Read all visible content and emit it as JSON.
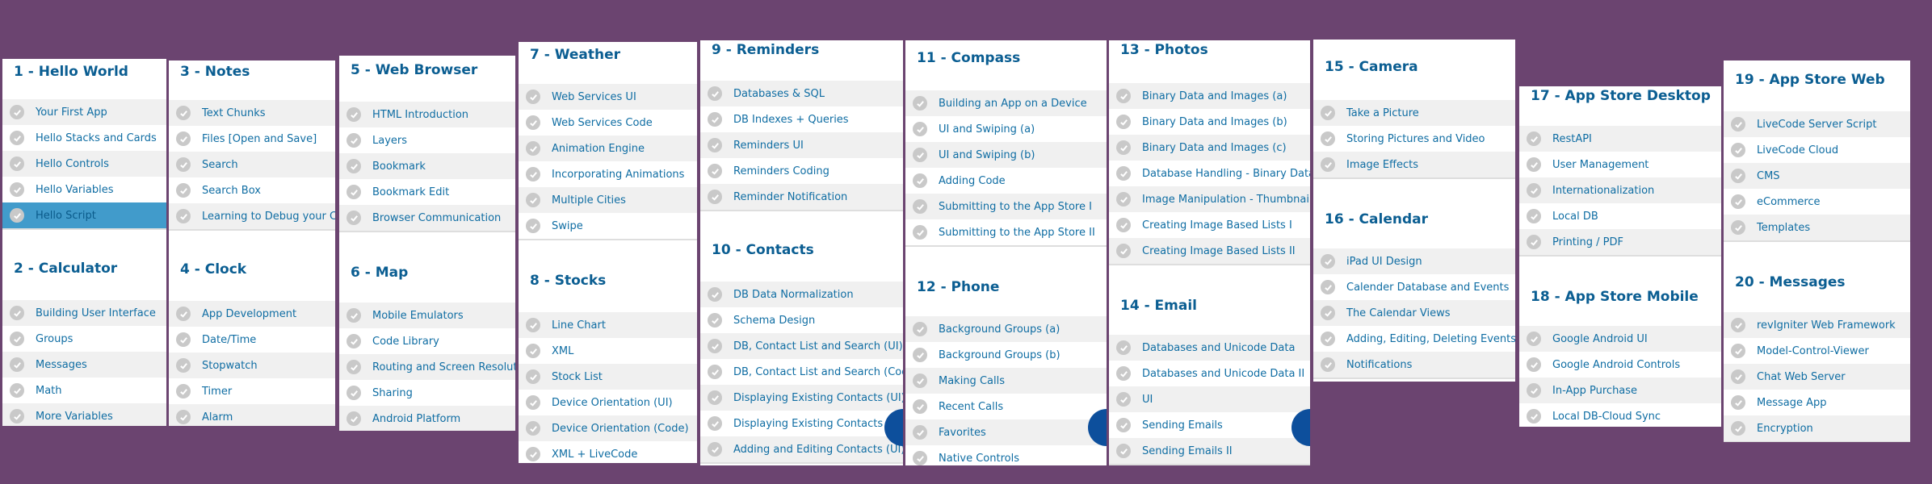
{
  "colors": {
    "background": "#6b4470",
    "title": "#0b5e92",
    "item_text": "#0f6da3",
    "selected_row": "#419bcb",
    "check_icon": "#c9c9c9",
    "fab": "#0d4f9c"
  },
  "columns": [
    {
      "sections": [
        {
          "title": "1 - Hello World",
          "items": [
            "Your First App",
            "Hello Stacks and Cards",
            "Hello Controls",
            "Hello Variables",
            "Hello Script"
          ],
          "selected_index": 4
        },
        {
          "title": "2 - Calculator",
          "items": [
            "Building User Interface",
            "Groups",
            "Messages",
            "Math",
            "More Variables"
          ]
        }
      ]
    },
    {
      "sections": [
        {
          "title": "3 - Notes",
          "items": [
            "Text Chunks",
            "Files [Open and Save]",
            "Search",
            "Search Box",
            "Learning to Debug your Code"
          ]
        },
        {
          "title": "4 - Clock",
          "items": [
            "App Development",
            "Date/Time",
            "Stopwatch",
            "Timer",
            "Alarm"
          ]
        }
      ]
    },
    {
      "sections": [
        {
          "title": "5 - Web Browser",
          "items": [
            "HTML Introduction",
            "Layers",
            "Bookmark",
            "Bookmark Edit",
            "Browser Communication"
          ]
        },
        {
          "title": "6 - Map",
          "items": [
            "Mobile Emulators",
            "Code Library",
            "Routing and Screen Resolution",
            "Sharing",
            "Android Platform"
          ]
        }
      ]
    },
    {
      "sections": [
        {
          "title": "7 - Weather",
          "items": [
            "Web Services UI",
            "Web Services Code",
            "Animation Engine",
            "Incorporating Animations",
            "Multiple Cities",
            "Swipe"
          ]
        },
        {
          "title": "8 - Stocks",
          "items": [
            "Line Chart",
            "XML",
            "Stock List",
            "Device Orientation (UI)",
            "Device Orientation (Code)",
            "XML + LiveCode"
          ]
        }
      ]
    },
    {
      "sections": [
        {
          "title": "9 - Reminders",
          "items": [
            "Databases & SQL",
            "DB Indexes + Queries",
            "Reminders UI",
            "Reminders Coding",
            "Reminder Notification"
          ]
        },
        {
          "title": "10 - Contacts",
          "items": [
            "DB Data Normalization",
            "Schema Design",
            "DB, Contact List and Search (UI)",
            "DB, Contact List and Search (Code)",
            "Displaying Existing Contacts (UI)",
            "Displaying Existing Contacts (Code)",
            "Adding and Editing Contacts (UI)"
          ]
        }
      ]
    },
    {
      "sections": [
        {
          "title": "11 - Compass",
          "items": [
            "Building an App on a Device",
            "UI and Swiping (a)",
            "UI and Swiping (b)",
            "Adding Code",
            "Submitting to the App Store I",
            "Submitting to the App Store II"
          ]
        },
        {
          "title": "12 - Phone",
          "items": [
            "Background Groups (a)",
            "Background Groups (b)",
            "Making Calls",
            "Recent Calls",
            "Favorites",
            "Native Controls"
          ]
        }
      ]
    },
    {
      "sections": [
        {
          "title": "13 - Photos",
          "items": [
            "Binary Data and Images (a)",
            "Binary Data and Images (b)",
            "Binary Data and Images (c)",
            "Database Handling - Binary Data",
            "Image Manipulation - Thumbnails",
            "Creating Image Based Lists I",
            "Creating Image Based Lists II"
          ]
        },
        {
          "title": "14 - Email",
          "items": [
            "Databases and Unicode Data",
            "Databases and Unicode Data II",
            "UI",
            "Sending Emails",
            "Sending Emails II"
          ]
        }
      ]
    },
    {
      "sections": [
        {
          "title": "15 - Camera",
          "items": [
            "Take a Picture",
            "Storing Pictures and Video",
            "Image Effects"
          ]
        },
        {
          "title": "16 - Calendar",
          "items": [
            "iPad UI Design",
            "Calender Database and Events",
            "The Calendar Views",
            "Adding, Editing, Deleting Events",
            "Notifications"
          ]
        }
      ]
    },
    {
      "sections": [
        {
          "title": "17 - App Store Desktop",
          "items": [
            "RestAPI",
            "User Management",
            "Internationalization",
            "Local DB",
            "Printing / PDF"
          ]
        },
        {
          "title": "18 - App Store Mobile",
          "items": [
            "Google Android UI",
            "Google Android Controls",
            "In-App Purchase",
            "Local DB-Cloud Sync"
          ]
        }
      ]
    },
    {
      "sections": [
        {
          "title": "19 - App Store Web",
          "items": [
            "LiveCode Server Script",
            "LiveCode Cloud",
            "CMS",
            "eCommerce",
            "Templates"
          ]
        },
        {
          "title": "20 - Messages",
          "items": [
            "revIgniter Web Framework",
            "Model-Control-Viewer",
            "Chat Web Server",
            "Message App",
            "Encryption"
          ]
        }
      ]
    }
  ]
}
